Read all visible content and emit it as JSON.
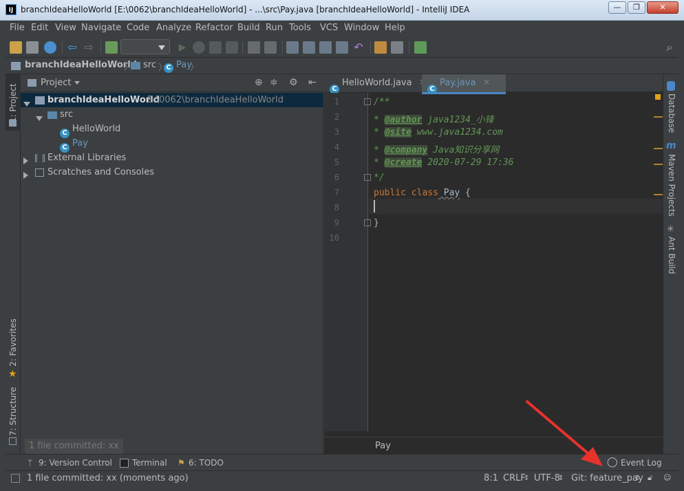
{
  "window": {
    "title": "branchIdeaHelloWorld [E:\\0062\\branchIdeaHelloWorld] - ...\\src\\Pay.java [branchIdeaHelloWorld] - IntelliJ IDEA",
    "app_icon": "IJ"
  },
  "menu": [
    "File",
    "Edit",
    "View",
    "Navigate",
    "Code",
    "Analyze",
    "Refactor",
    "Build",
    "Run",
    "Tools",
    "VCS",
    "Window",
    "Help"
  ],
  "navbar": {
    "project": "branchIdeaHelloWorld",
    "folder": "src",
    "file": "Pay"
  },
  "left_stripe": {
    "project_tab": "1: Project",
    "favorites_tab": "2: Favorites",
    "structure_tab": "7: Structure"
  },
  "project_panel": {
    "title": "Project",
    "tree": {
      "root_name": "branchIdeaHelloWorld",
      "root_path": "E:\\0062\\branchIdeaHelloWorld",
      "src": "src",
      "class1": "HelloWorld",
      "class2": "Pay",
      "ext_libs": "External Libraries",
      "scratches": "Scratches and Consoles"
    },
    "commit_tooltip": "1 file committed: xx"
  },
  "editor": {
    "tabs": [
      {
        "label": "HelloWorld.java"
      },
      {
        "label": "Pay.java"
      }
    ],
    "line_numbers": [
      "1",
      "2",
      "3",
      "4",
      "5",
      "6",
      "7",
      "8",
      "9",
      "10"
    ],
    "code": {
      "l1": "/**",
      "l2_star": " * ",
      "l2_tag": "@author",
      "l2_val": " java1234_小锋",
      "l3_tag": "@site",
      "l3_val": " www.java1234.com",
      "l4_tag": "@company",
      "l4_val": " Java知识分享网",
      "l5_tag": "@create",
      "l5_val": " 2020-07-29 17:36",
      "l6": " */",
      "l7_kw": "public class",
      "l7_name": " Pay",
      "l7_brace": " {",
      "l9": "}"
    },
    "breadcrumb": "Pay"
  },
  "right_stripe": {
    "database": "Database",
    "maven": "Maven Projects",
    "ant": "Ant Build"
  },
  "toolwindows": {
    "vcs": "9: Version Control",
    "terminal": "Terminal",
    "todo": "6: TODO",
    "event_log": "Event Log"
  },
  "status": {
    "message": "1 file committed: xx (moments ago)",
    "position": "8:1",
    "line_sep": "CRLF",
    "encoding": "UTF-8",
    "git": "Git: feature_pay"
  },
  "colors": {
    "bg": "#3c3f41",
    "editor_bg": "#2b2b2b",
    "comment": "#629755",
    "keyword": "#cc7832",
    "selection": "#0d293e",
    "annotation_arrow": "#e8322c"
  }
}
